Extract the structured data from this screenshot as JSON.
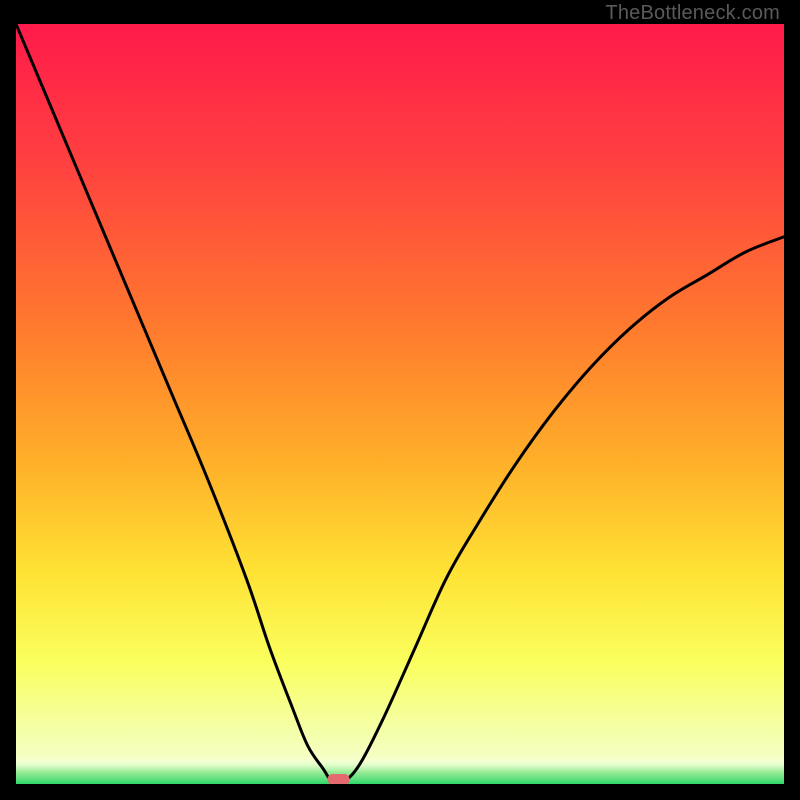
{
  "watermark": "TheBottleneck.com",
  "chart_data": {
    "type": "line",
    "title": "",
    "xlabel": "",
    "ylabel": "",
    "xlim": [
      0,
      100
    ],
    "ylim": [
      0,
      100
    ],
    "grid": false,
    "legend": false,
    "series": [
      {
        "name": "bottleneck-curve",
        "x": [
          0,
          5,
          10,
          15,
          20,
          25,
          30,
          33,
          36,
          38,
          40,
          41,
          42,
          43,
          45,
          48,
          52,
          56,
          60,
          65,
          70,
          75,
          80,
          85,
          90,
          95,
          100
        ],
        "y": [
          100,
          88,
          76,
          64,
          52,
          40,
          27,
          18,
          10,
          5,
          2,
          0.5,
          0.5,
          0.5,
          3,
          9,
          18,
          27,
          34,
          42,
          49,
          55,
          60,
          64,
          67,
          70,
          72
        ]
      }
    ],
    "marker": {
      "x": 42,
      "y": 0.6
    },
    "green_band": {
      "y0": 0,
      "y1": 3.5
    },
    "gradient_stops": [
      {
        "offset": 0.0,
        "color": "#ff1a4b"
      },
      {
        "offset": 0.18,
        "color": "#ff4040"
      },
      {
        "offset": 0.4,
        "color": "#ff7a2e"
      },
      {
        "offset": 0.58,
        "color": "#ffb129"
      },
      {
        "offset": 0.72,
        "color": "#ffe234"
      },
      {
        "offset": 0.84,
        "color": "#faff5e"
      },
      {
        "offset": 0.94,
        "color": "#f4ffb0"
      },
      {
        "offset": 1.0,
        "color": "#f9ffe0"
      }
    ]
  }
}
